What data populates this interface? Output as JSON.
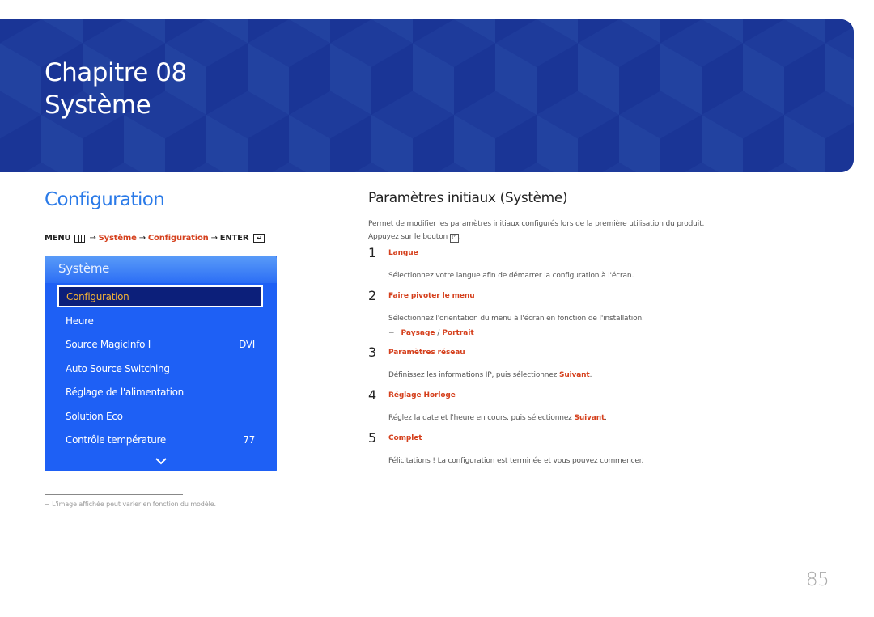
{
  "banner": {
    "chapter": "Chapitre 08",
    "title": "Système",
    "color": "#1e3a9c"
  },
  "left": {
    "section_title": "Configuration",
    "menu_path": {
      "menu_label": "MENU",
      "menu_icon": "menu-grid-icon",
      "arrow": "→",
      "step1": "Système",
      "step2": "Configuration",
      "enter_label": "ENTER",
      "enter_icon": "enter-icon"
    },
    "osd": {
      "title": "Système",
      "items": [
        {
          "label": "Configuration",
          "value": "",
          "selected": true
        },
        {
          "label": "Heure",
          "value": ""
        },
        {
          "label": "Source MagicInfo I",
          "value": "DVI"
        },
        {
          "label": "Auto Source Switching",
          "value": ""
        },
        {
          "label": "Réglage de l'alimentation",
          "value": ""
        },
        {
          "label": "Solution Eco",
          "value": ""
        },
        {
          "label": "Contrôle température",
          "value": "77"
        }
      ],
      "more_icon": "chevron-down-icon"
    },
    "footnote": "L'image affichée peut varier en fonction du modèle.",
    "footnote_dash": "−"
  },
  "right": {
    "heading": "Paramètres initiaux (Système)",
    "intro_line1": "Permet de modifier les paramètres initiaux configurés lors de la première utilisation du produit.",
    "intro_line2_pre": "Appuyez sur le bouton",
    "intro_line2_post": ".",
    "intro_icon": "power-icon",
    "steps": [
      {
        "num": "1",
        "title": "Langue",
        "desc_pre": "Sélectionnez votre langue afin de démarrer la configuration à l'écran.",
        "desc_bold": "",
        "desc_post": ""
      },
      {
        "num": "2",
        "title": "Faire pivoter le menu",
        "desc_pre": "Sélectionnez l'orientation du menu à l'écran en fonction de l'installation.",
        "desc_bold": "",
        "desc_post": "",
        "options": {
          "dash": "−",
          "opt1": "Paysage",
          "sep": " / ",
          "opt2": "Portrait"
        }
      },
      {
        "num": "3",
        "title": "Paramètres réseau",
        "desc_pre": "Définissez les informations IP, puis sélectionnez ",
        "desc_bold": "Suivant",
        "desc_post": "."
      },
      {
        "num": "4",
        "title": "Réglage Horloge",
        "desc_pre": "Réglez la date et l'heure en cours, puis sélectionnez ",
        "desc_bold": "Suivant",
        "desc_post": "."
      },
      {
        "num": "5",
        "title": "Complet",
        "desc_pre": "Félicitations ! La configuration est terminée et vous pouvez commencer.",
        "desc_bold": "",
        "desc_post": ""
      }
    ]
  },
  "page_number": "85",
  "colors": {
    "accent_red": "#d5401d",
    "heading_blue": "#2a7ae8",
    "osd_blue": "#1e60f5",
    "osd_selected": "#0c1f7a",
    "osd_selected_text": "#f5b335"
  }
}
